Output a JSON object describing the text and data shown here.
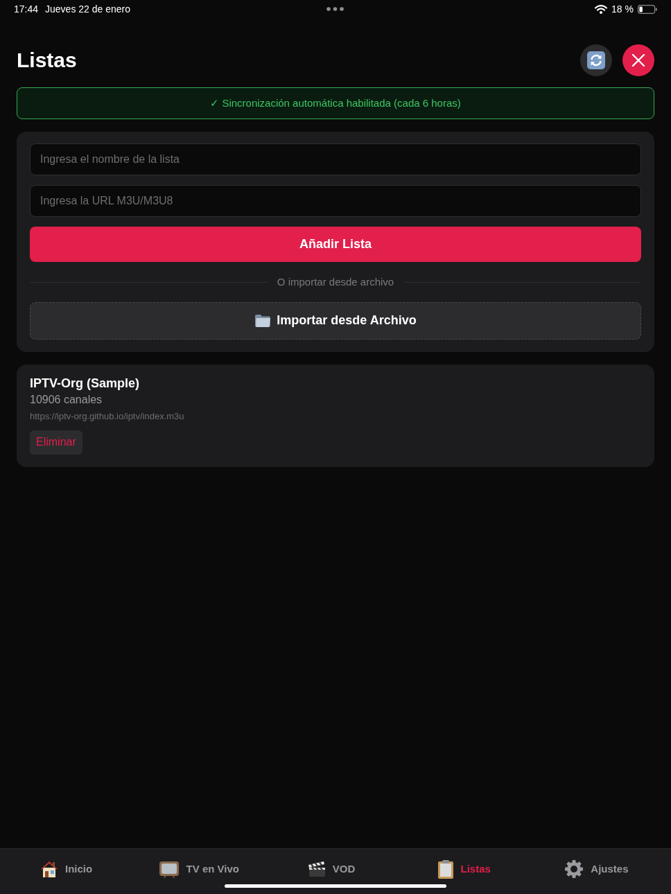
{
  "status_bar": {
    "time": "17:44",
    "date": "Jueves 22 de enero",
    "battery": "18 %"
  },
  "header": {
    "title": "Listas"
  },
  "sync_banner": {
    "text": "✓ Sincronización automática habilitada (cada 6 horas)"
  },
  "form": {
    "name_field": {
      "placeholder": "Ingresa el nombre de la lista"
    },
    "url_field": {
      "placeholder": "Ingresa la URL M3U/M3U8"
    },
    "add_button": "Añadir Lista",
    "divider": "O importar desde archivo",
    "import_button": "Importar desde Archivo"
  },
  "lists": [
    {
      "name": "IPTV-Org (Sample)",
      "channels": "10906 canales",
      "url": "https://iptv-org.github.io/iptv/index.m3u",
      "delete_button": "Eliminar"
    }
  ],
  "tab_bar": [
    {
      "label": "Inicio",
      "selected": false
    },
    {
      "label": "TV en Vivo",
      "selected": false
    },
    {
      "label": "VOD",
      "selected": false
    },
    {
      "label": "Listas",
      "selected": true
    },
    {
      "label": "Ajustes",
      "selected": false
    }
  ]
}
